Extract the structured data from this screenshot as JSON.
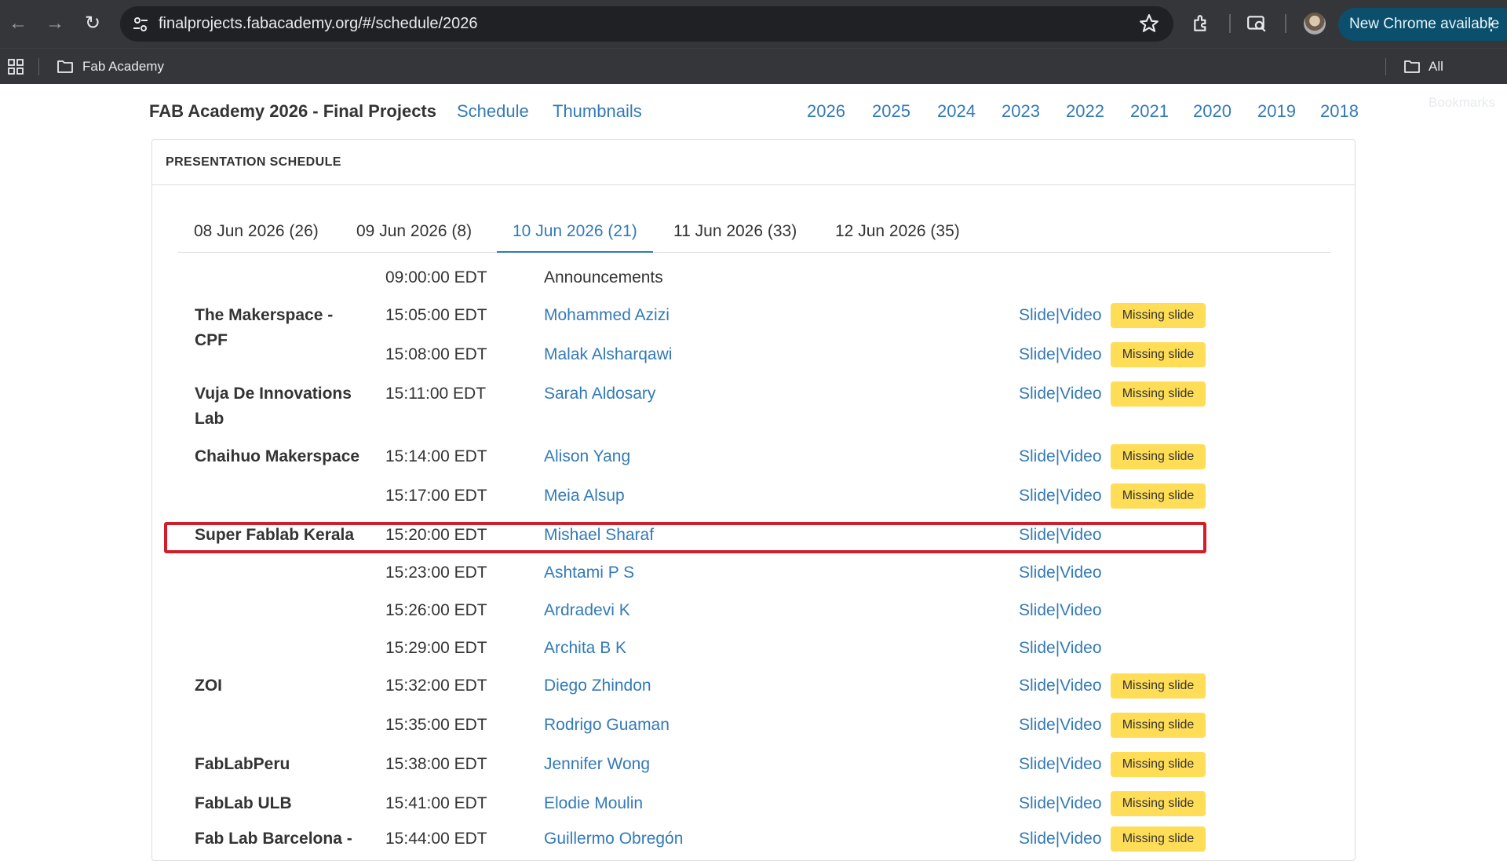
{
  "browser": {
    "url": "finalprojects.fabacademy.org/#/schedule/2026",
    "update_label": "New Chrome available",
    "bookmarks": [
      {
        "label": "Fab Academy"
      },
      {
        "label": "All Bookmarks"
      }
    ]
  },
  "site": {
    "brand": "FAB Academy 2026 - Final Projects",
    "nav_links": [
      "Schedule",
      "Thumbnails"
    ],
    "years": [
      "2026",
      "2025",
      "2024",
      "2023",
      "2022",
      "2021",
      "2020",
      "2019",
      "2018"
    ]
  },
  "panel": {
    "heading": "PRESENTATION SCHEDULE",
    "tabs": [
      {
        "label": "08 Jun 2026 (26)",
        "active": false
      },
      {
        "label": "09 Jun 2026 (8)",
        "active": false
      },
      {
        "label": "10 Jun 2026 (21)",
        "active": true
      },
      {
        "label": "11 Jun 2026 (33)",
        "active": false
      },
      {
        "label": "12 Jun 2026 (35)",
        "active": false
      }
    ],
    "links": {
      "slide": "Slide",
      "sep": "|",
      "video": "Video"
    },
    "badge_text": "Missing slide",
    "rows": [
      {
        "lab": "",
        "time": "09:00:00 EDT",
        "name": "Announcements",
        "is_link": false,
        "links": false,
        "missing": false
      },
      {
        "lab": "The Makerspace - CPF",
        "time": "15:05:00 EDT",
        "name": "Mohammed Azizi",
        "is_link": true,
        "links": true,
        "missing": true
      },
      {
        "lab": "",
        "time": "15:08:00 EDT",
        "name": "Malak Alsharqawi",
        "is_link": true,
        "links": true,
        "missing": true
      },
      {
        "lab": "Vuja De Innovations Lab",
        "time": "15:11:00 EDT",
        "name": "Sarah Aldosary",
        "is_link": true,
        "links": true,
        "missing": true
      },
      {
        "lab": "Chaihuo Makerspace",
        "time": "15:14:00 EDT",
        "name": "Alison Yang",
        "is_link": true,
        "links": true,
        "missing": true
      },
      {
        "lab": "",
        "time": "15:17:00 EDT",
        "name": "Meia Alsup",
        "is_link": true,
        "links": true,
        "missing": true
      },
      {
        "lab": "Super Fablab Kerala",
        "time": "15:20:00 EDT",
        "name": "Mishael Sharaf",
        "is_link": true,
        "links": true,
        "missing": false
      },
      {
        "lab": "",
        "time": "15:23:00 EDT",
        "name": "Ashtami P S",
        "is_link": true,
        "links": true,
        "missing": false
      },
      {
        "lab": "",
        "time": "15:26:00 EDT",
        "name": "Ardradevi K",
        "is_link": true,
        "links": true,
        "missing": false
      },
      {
        "lab": "",
        "time": "15:29:00 EDT",
        "name": "Archita B K",
        "is_link": true,
        "links": true,
        "missing": false
      },
      {
        "lab": "ZOI",
        "time": "15:32:00 EDT",
        "name": "Diego Zhindon",
        "is_link": true,
        "links": true,
        "missing": true
      },
      {
        "lab": "",
        "time": "15:35:00 EDT",
        "name": "Rodrigo Guaman",
        "is_link": true,
        "links": true,
        "missing": true
      },
      {
        "lab": "FabLabPeru",
        "time": "15:38:00 EDT",
        "name": "Jennifer Wong",
        "is_link": true,
        "links": true,
        "missing": true
      },
      {
        "lab": "FabLab ULB",
        "time": "15:41:00 EDT",
        "name": "Elodie Moulin",
        "is_link": true,
        "links": true,
        "missing": true
      },
      {
        "lab": "Fab Lab Barcelona -",
        "time": "15:44:00 EDT",
        "name": "Guillermo Obregón",
        "is_link": true,
        "links": true,
        "missing": true
      }
    ]
  }
}
